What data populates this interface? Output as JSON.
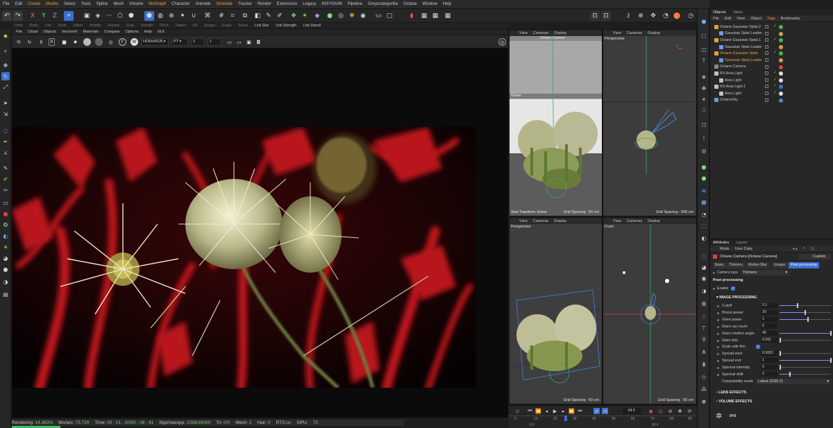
{
  "menubar": {
    "items": [
      "File",
      "Edit",
      "Create",
      "Modes",
      "Select",
      "Tools",
      "Spline",
      "Mesh",
      "Volume",
      "MoGraph",
      "Character",
      "Animate",
      "Simulate",
      "Tracker",
      "Render",
      "Extensions",
      "Legacy",
      "INSYDIUM",
      "Pipeline",
      "Greyscalegorilla",
      "Octane",
      "Window",
      "Help"
    ],
    "highlighted": [
      "Create",
      "Modes",
      "MoGraph",
      "Simulate"
    ]
  },
  "toolbar1": {
    "axis_labels": [
      "X",
      "Y",
      "Z"
    ]
  },
  "toolbar2": {
    "items": [
      "Undo",
      "Redo",
      "Live",
      "Knife",
      "Inflate",
      "Amplify",
      "Repeat",
      "Grab",
      "Smooth",
      "Pinch",
      "Flatten",
      "Fill",
      "Scrape",
      "Erase",
      "Select",
      "Link Size",
      "Link Strength",
      "Link Stencil"
    ],
    "active": [
      "Link Size",
      "Link Strength",
      "Link Stencil"
    ]
  },
  "render_viewer": {
    "menu": [
      "File",
      "Cloud",
      "Objects",
      "Vectron®",
      "Materials",
      "Compare",
      "Options",
      "Help",
      "GUI"
    ],
    "color_space": "HDR/sRGB",
    "mode": "PT",
    "field_a": "1",
    "field_b": "1",
    "status": {
      "rendering_label": "Rendering:",
      "rendering_value": "14.363%",
      "ms_label": "Ms/sec:",
      "ms_value": "75.729",
      "time_label": "Time:",
      "time_value": "00 : 01 : 20/00 : 08 : 41",
      "spp_label": "Spp/maxspp:",
      "spp_value": "2298/16000",
      "tri_label": "Tri:",
      "tri_value": "0/0",
      "mesh_label": "Mesh:",
      "mesh_value": "2",
      "hair_label": "Hair:",
      "hair_value": "0",
      "rtx_label": "RTX:",
      "rtx_value": "on",
      "gpu_label": "GPU:",
      "gpu_value": "73"
    }
  },
  "viewports": {
    "menu": [
      "View",
      "Cameras",
      "Display"
    ],
    "tl": {
      "label": "Rotate",
      "camera_label": "Octane Camera",
      "grid": "Grid Spacing : 50 cm",
      "status": "View Transform: Scene"
    },
    "tr": {
      "label": "Perspective",
      "grid": "Grid Spacing : 500 cm"
    },
    "bl": {
      "label": "Perspective",
      "grid": "Grid Spacing : 50 cm"
    },
    "br": {
      "label": "Front",
      "grid": "Grid Spacing : 50 cm"
    }
  },
  "timeline": {
    "frame": "24 F",
    "ticks": [
      "0",
      "10",
      "20",
      "30",
      "40",
      "50",
      "60",
      "70",
      "80",
      "90"
    ],
    "start": "0 F",
    "end": "90 F"
  },
  "objects_panel": {
    "tabs": [
      "Objects",
      "Takes"
    ],
    "menu": [
      "File",
      "Edit",
      "View",
      "Object",
      "Tags",
      "Bookmarks"
    ],
    "active_menu": "Tags",
    "rows": [
      {
        "name": "Octane Gaussian Splat.2",
        "indent": 0,
        "color": "#c8c8c8",
        "icon": "#e0a040",
        "tag": "#4caf50",
        "check": true
      },
      {
        "name": "Gaussian Splat Loader",
        "indent": 1,
        "color": "#c8c8c8",
        "icon": "#6a9ae0",
        "tag": "#d0a040",
        "check": false
      },
      {
        "name": "Octane Gaussian Splat.1",
        "indent": 0,
        "color": "#c8c8c8",
        "icon": "#e0a040",
        "tag": "#4caf50",
        "check": true
      },
      {
        "name": "Gaussian Splat Loader",
        "indent": 1,
        "color": "#c8c8c8",
        "icon": "#6a9ae0",
        "tag": "#d0a040",
        "check": false
      },
      {
        "name": "Octane Gaussian Splat",
        "indent": 0,
        "color": "#f0a03c",
        "icon": "#e0a040",
        "tag": "#4caf50",
        "check": true
      },
      {
        "name": "Gaussian Splat Loader",
        "indent": 1,
        "color": "#f0a03c",
        "icon": "#6a9ae0",
        "tag": "#d0a040",
        "check": false
      },
      {
        "name": "Octane Camera",
        "indent": 0,
        "color": "#c8c8c8",
        "icon": "#8a8a8a",
        "tag": "#e04040",
        "check": false
      },
      {
        "name": "RS Area Light",
        "indent": 0,
        "color": "#c8c8c8",
        "icon": "#c0c0c0",
        "tag": "#dddddd",
        "check": true
      },
      {
        "name": "Area Light",
        "indent": 1,
        "color": "#c8c8c8",
        "icon": "#c0c0c0",
        "tag": "#dddddd",
        "check": true
      },
      {
        "name": "RS Area Light.1",
        "indent": 0,
        "color": "#c8c8c8",
        "icon": "#c0c0c0",
        "tag": "#3d6fd1",
        "check": true
      },
      {
        "name": "Area Light",
        "indent": 1,
        "color": "#c8c8c8",
        "icon": "#c0c0c0",
        "tag": "#dddddd",
        "check": true
      },
      {
        "name": "OctaneSky",
        "indent": 0,
        "color": "#c8c8c8",
        "icon": "#5aa0e0",
        "tag": "#3d8fe0",
        "check": false
      }
    ]
  },
  "attributes_panel": {
    "tabs": [
      "Attributes",
      "Layers"
    ],
    "menu": [
      "Mode",
      "User Data"
    ],
    "object_title": "Octane Camera [Octane Camera]",
    "preset": "Custom",
    "subtabs": [
      "Basic",
      "Thinlens",
      "Motion Blur",
      "Imager",
      "Post processing"
    ],
    "active_subtab": "Post processing",
    "camera_type_label": "Camera type",
    "camera_type_value": "Thinlens",
    "section_title": "Post processing",
    "enable_label": "Enable",
    "image_processing_title": "IMAGE PROCESSING",
    "params": [
      {
        "label": "Cutoff",
        "value": "0.1",
        "fill": 0.35
      },
      {
        "label": "Bloom power",
        "value": "20",
        "fill": 0.5
      },
      {
        "label": "Glare power",
        "value": "1",
        "fill": 0.55
      },
      {
        "label": "Glare ray count",
        "value": "5",
        "fill": null
      },
      {
        "label": "Glare rotation angle",
        "value": "45",
        "fill": 1.0
      },
      {
        "label": "Glare blur",
        "value": "0.001",
        "fill": 0.02
      },
      {
        "label": "Scale with film",
        "value": "",
        "fill": null,
        "checkbox": true
      },
      {
        "label": "Spread start",
        "value": "0.0001",
        "fill": 0.02
      },
      {
        "label": "Spread end",
        "value": "1",
        "fill": 1.0
      },
      {
        "label": "Spectral intensity",
        "value": "0",
        "fill": 0.0
      },
      {
        "label": "Spectral shift",
        "value": "2",
        "fill": 0.2
      }
    ],
    "compat_label": "Compatibility mode",
    "compat_value": "Latest (2025.2)",
    "lens_effects": "LENS EFFECTS",
    "volume_effects": "VOLUME EFFECTS"
  },
  "colors": {
    "accent": "#f0a03c",
    "selection_blue": "#3d6fd1",
    "check_green": "#5ed05e"
  }
}
